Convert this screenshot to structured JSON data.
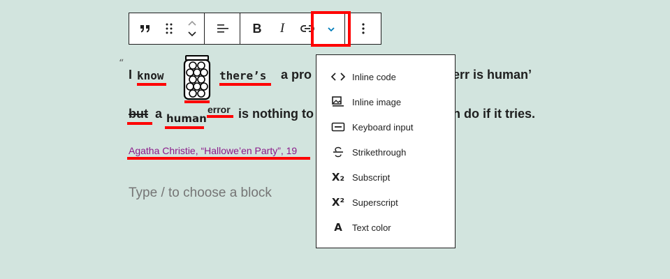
{
  "toolbar": {
    "buttons": [
      {
        "name": "quote-icon",
        "label": "Quote"
      },
      {
        "name": "drag-handle-icon",
        "label": "Drag"
      },
      {
        "name": "move-up-down-icon",
        "label": "Move"
      },
      {
        "name": "align-left-icon",
        "label": "Align"
      },
      {
        "name": "link-icon",
        "label": "Link"
      },
      {
        "name": "more-options-icon",
        "label": "Options"
      }
    ],
    "bold_label": "B",
    "italic_label": "I",
    "more_rich_text_icon": "chevron-down-icon",
    "accent": "#007cba",
    "highlight": "#ff0000"
  },
  "quote": {
    "mark": "“",
    "line1": {
      "w1": "I",
      "w2": "know",
      "w3": "there’s",
      "w4": "a pro",
      "w5": "err is human’"
    },
    "line2": {
      "w1": "but",
      "w2": "a",
      "w3": "human",
      "w4": "error",
      "w5": "is nothing to",
      "w6": "n do if it tries."
    },
    "citation": "Agatha Christie, “Hallowe’en Party”, 19"
  },
  "placeholder": "Type / to choose a block",
  "dropdown": {
    "items": [
      {
        "icon": "code-icon",
        "label": "Inline code"
      },
      {
        "icon": "image-icon",
        "label": "Inline image"
      },
      {
        "icon": "keyboard-icon",
        "label": "Keyboard input"
      },
      {
        "icon": "strikethrough-icon",
        "label": "Strikethrough"
      },
      {
        "icon": "subscript-icon",
        "label": "Subscript",
        "glyph": "X₂"
      },
      {
        "icon": "superscript-icon",
        "label": "Superscript",
        "glyph": "X²"
      },
      {
        "icon": "text-color-icon",
        "label": "Text color",
        "glyph": "A"
      }
    ]
  },
  "colors": {
    "background": "#d2e4de",
    "citation": "#8a1a8a",
    "placeholder": "#757575"
  }
}
